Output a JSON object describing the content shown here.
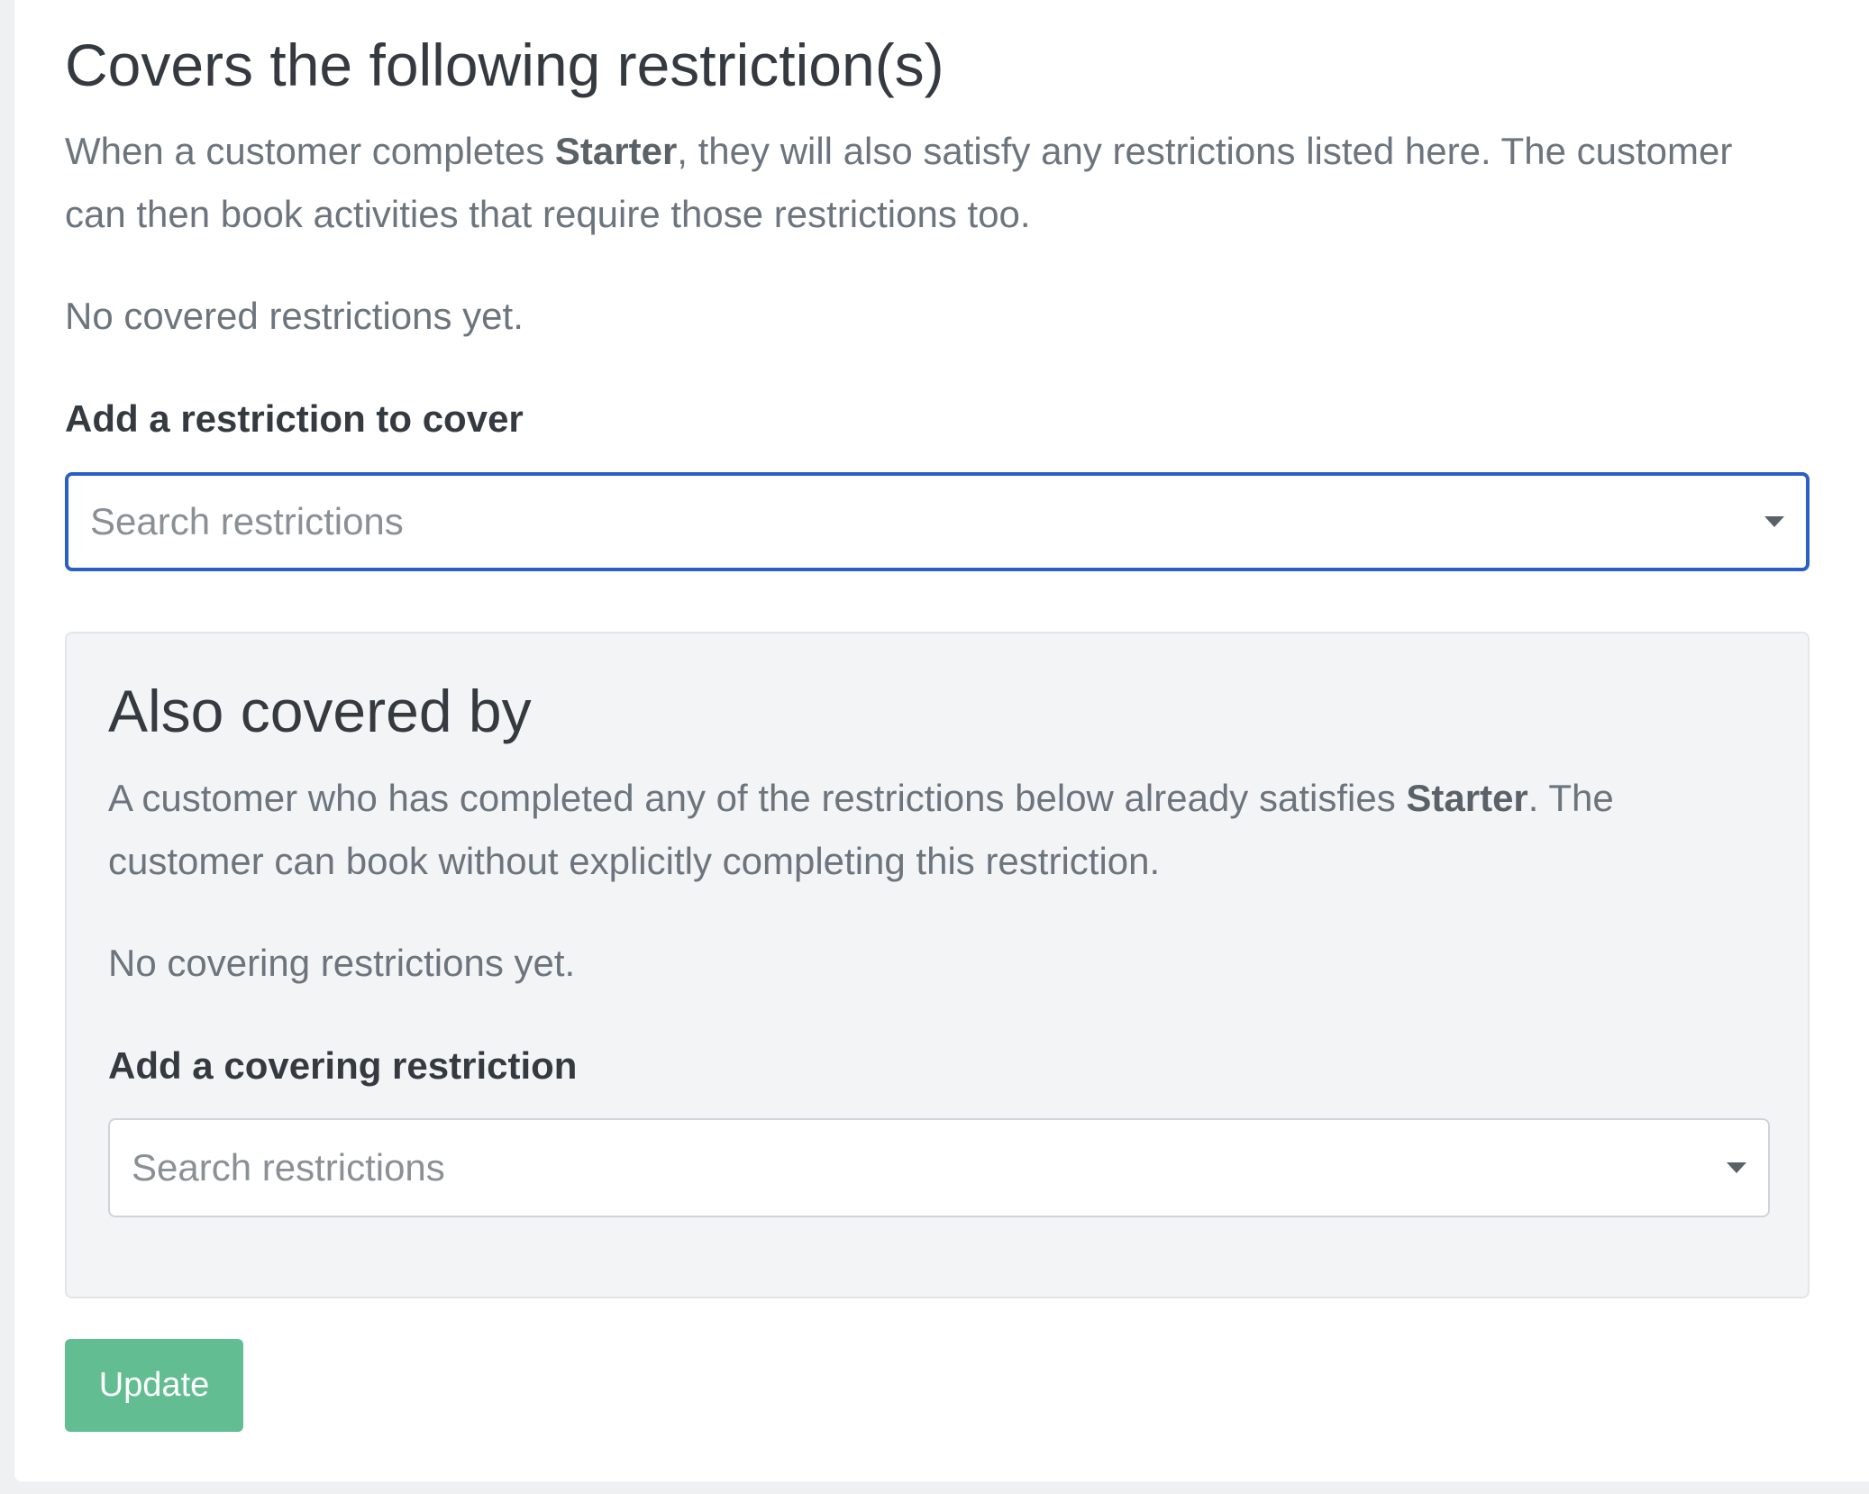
{
  "covers": {
    "title": "Covers the following restriction(s)",
    "description": {
      "before": "When a customer completes ",
      "name": "Starter",
      "after": ", they will also satisfy any restrictions listed here. The customer can then book activities that require those restrictions too."
    },
    "empty_text": "No covered restrictions yet.",
    "add_label": "Add a restriction to cover",
    "search_placeholder": "Search restrictions",
    "search_value": ""
  },
  "covered_by": {
    "title": "Also covered by",
    "description": {
      "before": "A customer who has completed any of the restrictions below already satisfies ",
      "name": "Starter",
      "after": ". The customer can book without explicitly completing this restriction."
    },
    "empty_text": "No covering restrictions yet.",
    "add_label": "Add a covering restriction",
    "search_placeholder": "Search restrictions",
    "search_value": ""
  },
  "actions": {
    "update_label": "Update",
    "update_color": "#62bd92"
  },
  "colors": {
    "focus_border": "#2a5fc4",
    "card_background": "#f3f4f6"
  },
  "icons": {
    "dropdown": "caret-down-icon"
  }
}
